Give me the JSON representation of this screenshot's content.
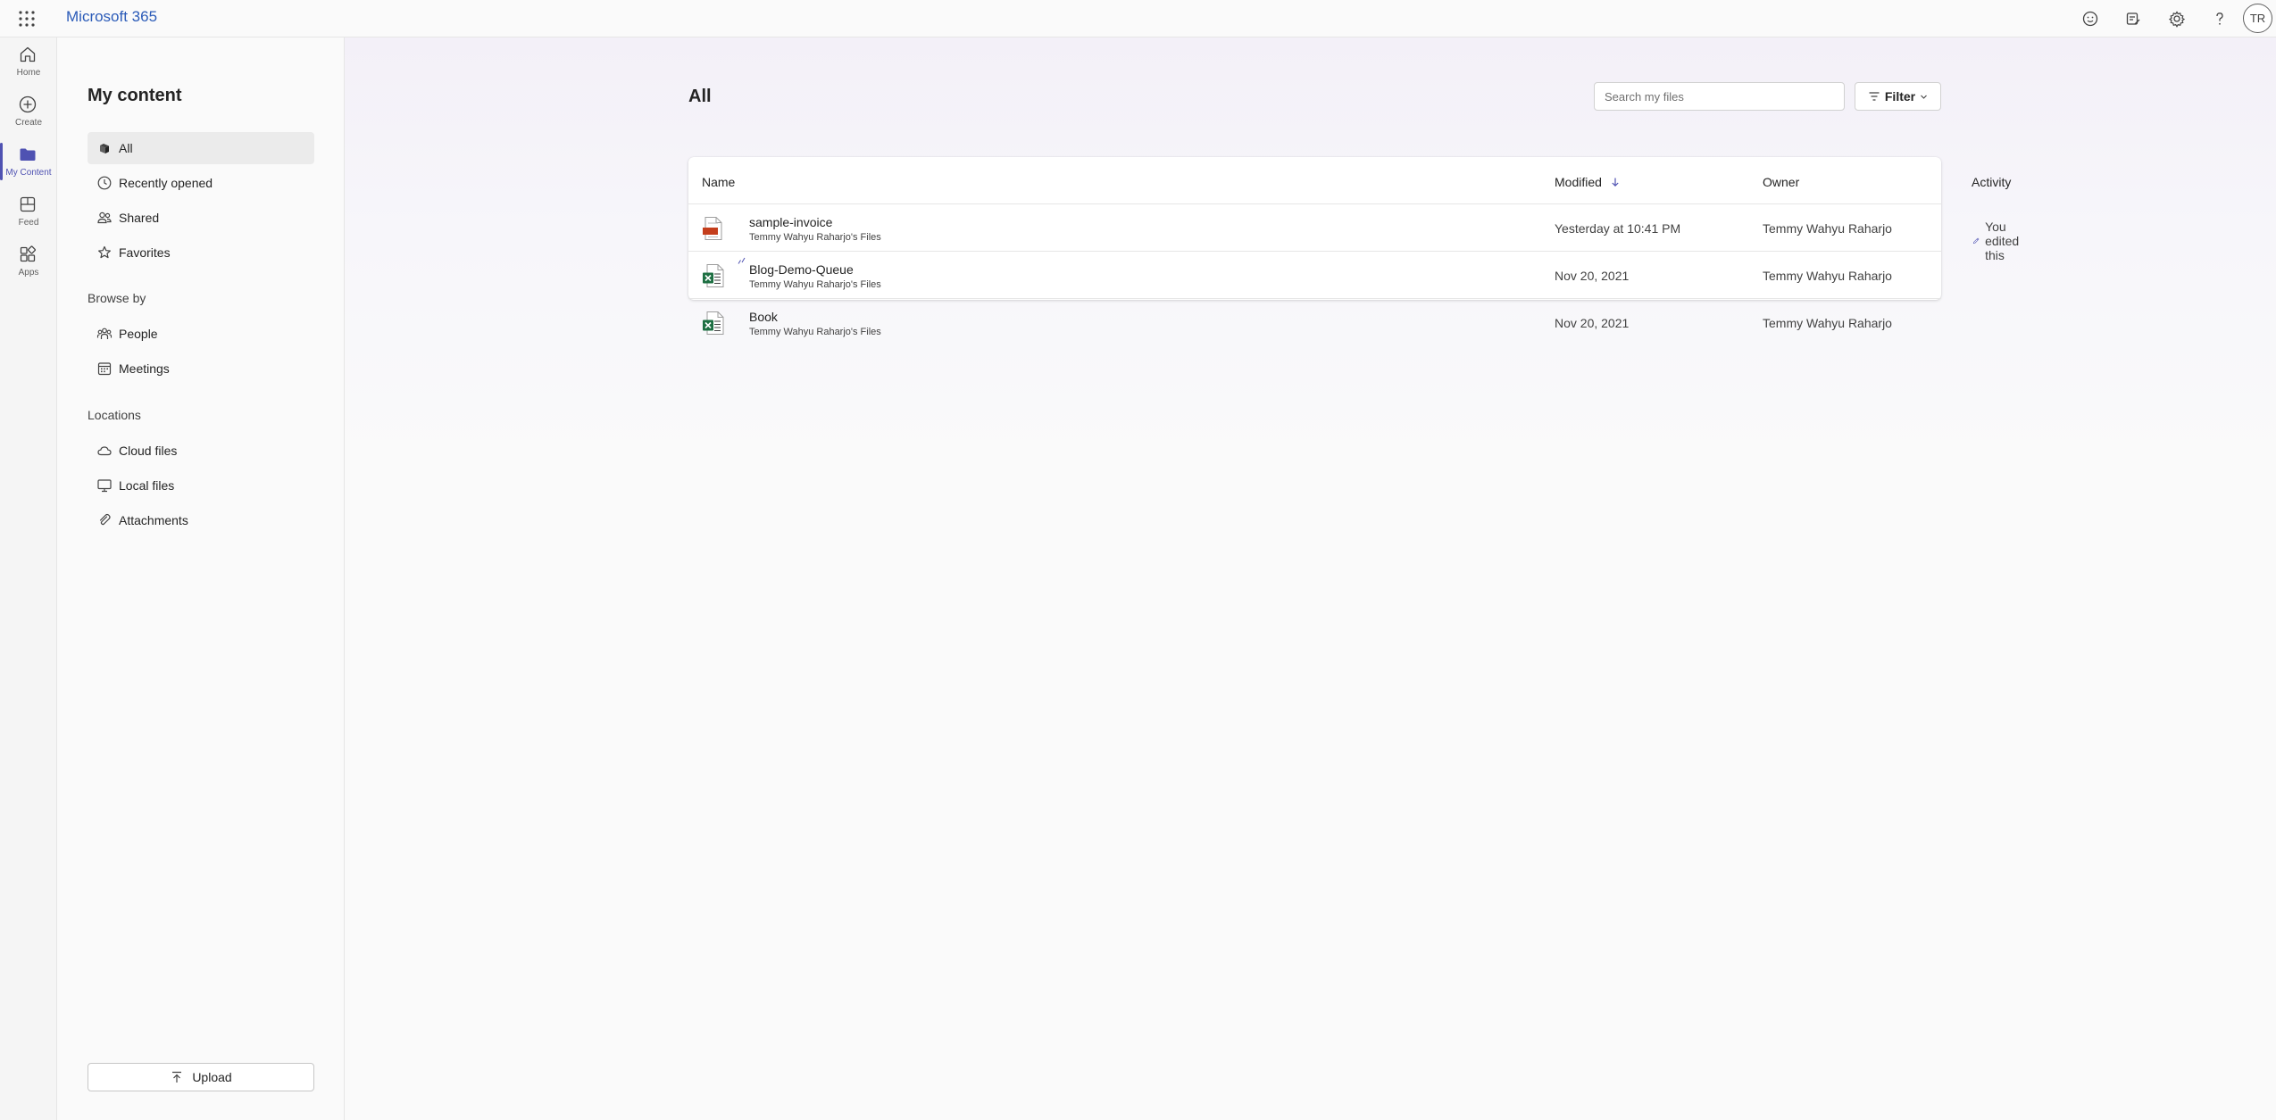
{
  "header": {
    "brand": "Microsoft 365",
    "avatar_initials": "TR",
    "icons": [
      "waffle-icon",
      "feedback-icon",
      "whats-new-icon",
      "settings-icon",
      "help-icon"
    ]
  },
  "rail": {
    "items": [
      {
        "label": "Home",
        "icon": "home-icon"
      },
      {
        "label": "Create",
        "icon": "create-icon"
      },
      {
        "label": "My Content",
        "icon": "folder-icon",
        "active": true
      },
      {
        "label": "Feed",
        "icon": "feed-icon"
      },
      {
        "label": "Apps",
        "icon": "apps-icon"
      }
    ]
  },
  "sidebar": {
    "title": "My content",
    "items": [
      {
        "label": "All",
        "icon": "all-icon",
        "selected": true
      },
      {
        "label": "Recently opened",
        "icon": "clock-icon"
      },
      {
        "label": "Shared",
        "icon": "people-icon"
      },
      {
        "label": "Favorites",
        "icon": "star-icon"
      }
    ],
    "browse_heading": "Browse by",
    "browse_items": [
      {
        "label": "People",
        "icon": "people-group-icon"
      },
      {
        "label": "Meetings",
        "icon": "calendar-icon"
      }
    ],
    "locations_heading": "Locations",
    "location_items": [
      {
        "label": "Cloud files",
        "icon": "cloud-icon"
      },
      {
        "label": "Local files",
        "icon": "monitor-icon"
      },
      {
        "label": "Attachments",
        "icon": "attach-icon"
      }
    ],
    "upload_label": "Upload"
  },
  "main": {
    "title": "All",
    "search_placeholder": "Search my files",
    "filter_label": "Filter",
    "columns": {
      "name": "Name",
      "modified": "Modified",
      "owner": "Owner",
      "activity": "Activity"
    },
    "sort": {
      "column": "Modified",
      "direction": "descending"
    },
    "files": [
      {
        "name": "sample-invoice",
        "location": "Temmy Wahyu Raharjo's Files",
        "modified": "Yesterday at 10:41 PM",
        "owner": "Temmy Wahyu Raharjo",
        "activity": "You edited this",
        "type": "pdf"
      },
      {
        "name": "Blog-Demo-Queue",
        "location": "Temmy Wahyu Raharjo's Files",
        "modified": "Nov 20, 2021",
        "owner": "Temmy Wahyu Raharjo",
        "activity": "",
        "type": "excel"
      },
      {
        "name": "Book",
        "location": "Temmy Wahyu Raharjo's Files",
        "modified": "Nov 20, 2021",
        "owner": "Temmy Wahyu Raharjo",
        "activity": "",
        "type": "excel"
      }
    ]
  },
  "colors": {
    "brand": "#2b5bb8",
    "accent": "#4f52b2",
    "excel": "#1d6f42",
    "pdf": "#c43e1c"
  }
}
